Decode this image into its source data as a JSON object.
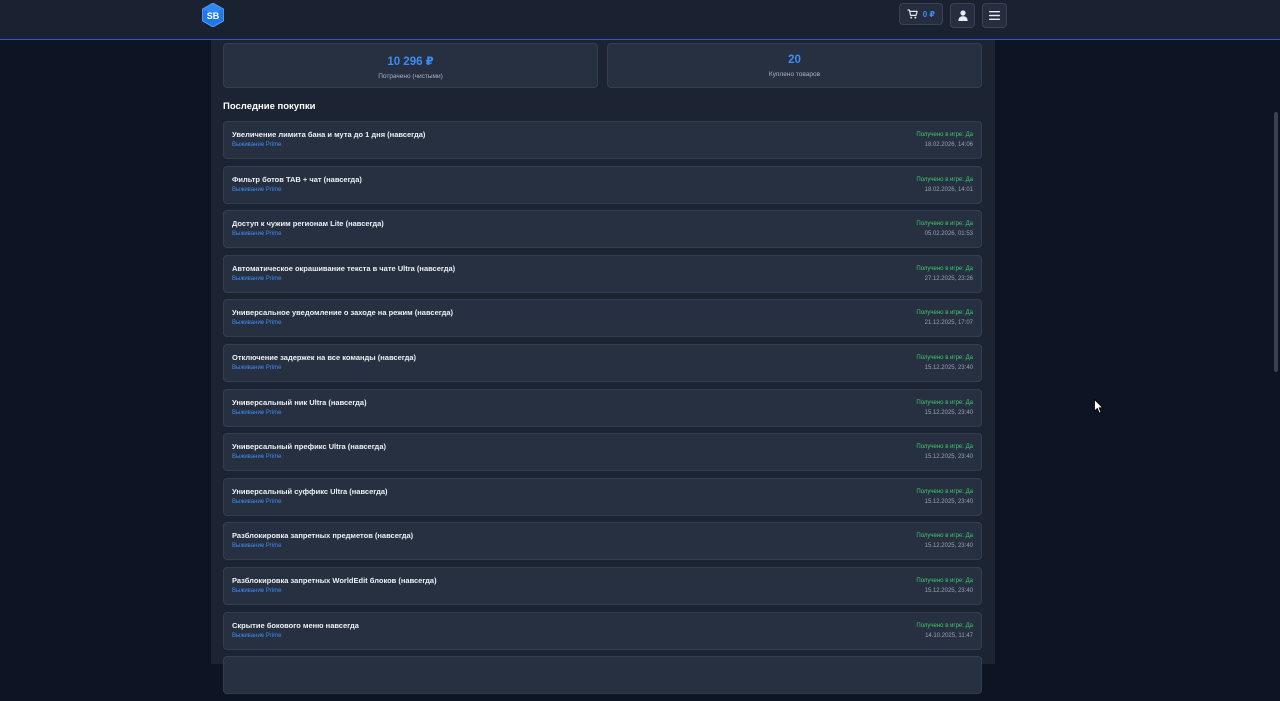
{
  "header": {
    "logo_text": "SB",
    "cart_amount": "0 ₽",
    "icons": {
      "cart": "cart-icon",
      "user": "user-icon",
      "menu": "menu-icon"
    }
  },
  "stats": [
    {
      "value": "10 296 ₽",
      "label": "Потрачено (чистыми)"
    },
    {
      "value": "20",
      "label": "Куплено товаров"
    }
  ],
  "section_title": "Последние покупки",
  "purchases": [
    {
      "title": "Увеличение лимита бана и мута до 1 дня (навсегда)",
      "server": "Выживание Prime",
      "status": "Получено в игре: Да",
      "date": "18.02.2026, 14:06"
    },
    {
      "title": "Фильтр ботов TAB + чат (навсегда)",
      "server": "Выживание Prime",
      "status": "Получено в игре: Да",
      "date": "18.02.2026, 14:01"
    },
    {
      "title": "Доступ к чужим регионам Lite (навсегда)",
      "server": "Выживание Prime",
      "status": "Получено в игре: Да",
      "date": "05.02.2026, 01:53"
    },
    {
      "title": "Автоматическое окрашивание текста в чате Ultra (навсегда)",
      "server": "Выживание Prime",
      "status": "Получено в игре: Да",
      "date": "27.12.2025, 23:26"
    },
    {
      "title": "Универсальное уведомление о заходе на режим (навсегда)",
      "server": "Выживание Prime",
      "status": "Получено в игре: Да",
      "date": "21.12.2025, 17:07"
    },
    {
      "title": "Отключение задержек на все команды (навсегда)",
      "server": "Выживание Prime",
      "status": "Получено в игре: Да",
      "date": "15.12.2025, 23:40"
    },
    {
      "title": "Универсальный ник Ultra (навсегда)",
      "server": "Выживание Prime",
      "status": "Получено в игре: Да",
      "date": "15.12.2025, 23:40"
    },
    {
      "title": "Универсальный префикс Ultra (навсегда)",
      "server": "Выживание Prime",
      "status": "Получено в игре: Да",
      "date": "15.12.2025, 23:40"
    },
    {
      "title": "Универсальный суффикс Ultra (навсегда)",
      "server": "Выживание Prime",
      "status": "Получено в игре: Да",
      "date": "15.12.2025, 23:40"
    },
    {
      "title": "Разблокировка запретных предметов (навсегда)",
      "server": "Выживание Prime",
      "status": "Получено в игре: Да",
      "date": "15.12.2025, 23:40"
    },
    {
      "title": "Разблокировка запретных WorldEdit блоков (навсегда)",
      "server": "Выживание Prime",
      "status": "Получено в игре: Да",
      "date": "15.12.2025, 23:40"
    },
    {
      "title": "Скрытие бокового меню навсегда",
      "server": "Выживание Prime",
      "status": "Получено в игре: Да",
      "date": "14.10.2025, 11:47"
    },
    {
      "title": "",
      "server": "",
      "status": "",
      "date": ""
    }
  ],
  "colors": {
    "accent": "#3c8cf5",
    "status_ok": "#3ec96b",
    "background": "#0d1524",
    "panel": "#1c2332",
    "card": "#273041"
  }
}
